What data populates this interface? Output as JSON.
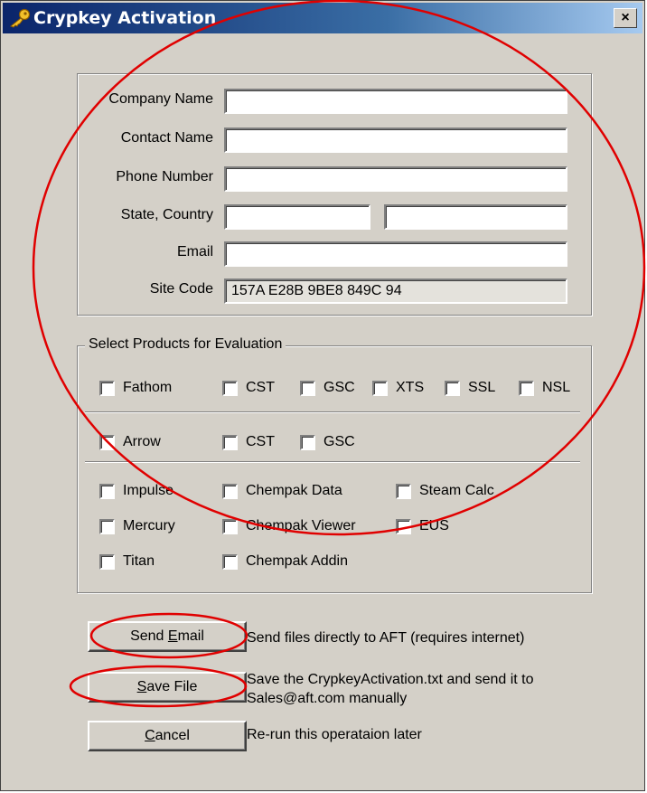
{
  "window": {
    "title": "Crypkey Activation",
    "close_label": "×"
  },
  "contact": {
    "company_label": "Company Name",
    "contact_label": "Contact Name",
    "phone_label": "Phone Number",
    "state_country_label": "State, Country",
    "email_label": "Email",
    "site_code_label": "Site Code",
    "company_value": "",
    "contact_value": "",
    "phone_value": "",
    "state_value": "",
    "country_value": "",
    "email_value": "",
    "site_code_value": "157A E28B 9BE8 849C 94"
  },
  "products": {
    "legend": "Select Products for Evaluation",
    "fathom": "Fathom",
    "fathom_cst": "CST",
    "fathom_gsc": "GSC",
    "fathom_xts": "XTS",
    "fathom_ssl": "SSL",
    "fathom_nsl": "NSL",
    "arrow": "Arrow",
    "arrow_cst": "CST",
    "arrow_gsc": "GSC",
    "impulse": "Impulse",
    "chempak_data": "Chempak Data",
    "steam_calc": "Steam Calc",
    "mercury": "Mercury",
    "chempak_viewer": "Chempak Viewer",
    "eus": "EUS",
    "titan": "Titan",
    "chempak_addin": "Chempak Addin"
  },
  "actions": {
    "send_email_prefix": "Send ",
    "send_email_mnemonic": "E",
    "send_email_suffix": "mail",
    "send_email_desc": "Send files directly to AFT (requires internet)",
    "save_file_mnemonic": "S",
    "save_file_suffix": "ave File",
    "save_file_desc_line1": "Save the CrypkeyActivation.txt and send it to",
    "save_file_desc_line2": "Sales@aft.com manually",
    "cancel_mnemonic": "C",
    "cancel_suffix": "ancel",
    "cancel_desc": "Re-run this operataion later"
  },
  "colors": {
    "dialog_face": "#d4d0c8",
    "title_start": "#0a246a",
    "title_end": "#a6caf0",
    "annotation_red": "#e00000"
  }
}
